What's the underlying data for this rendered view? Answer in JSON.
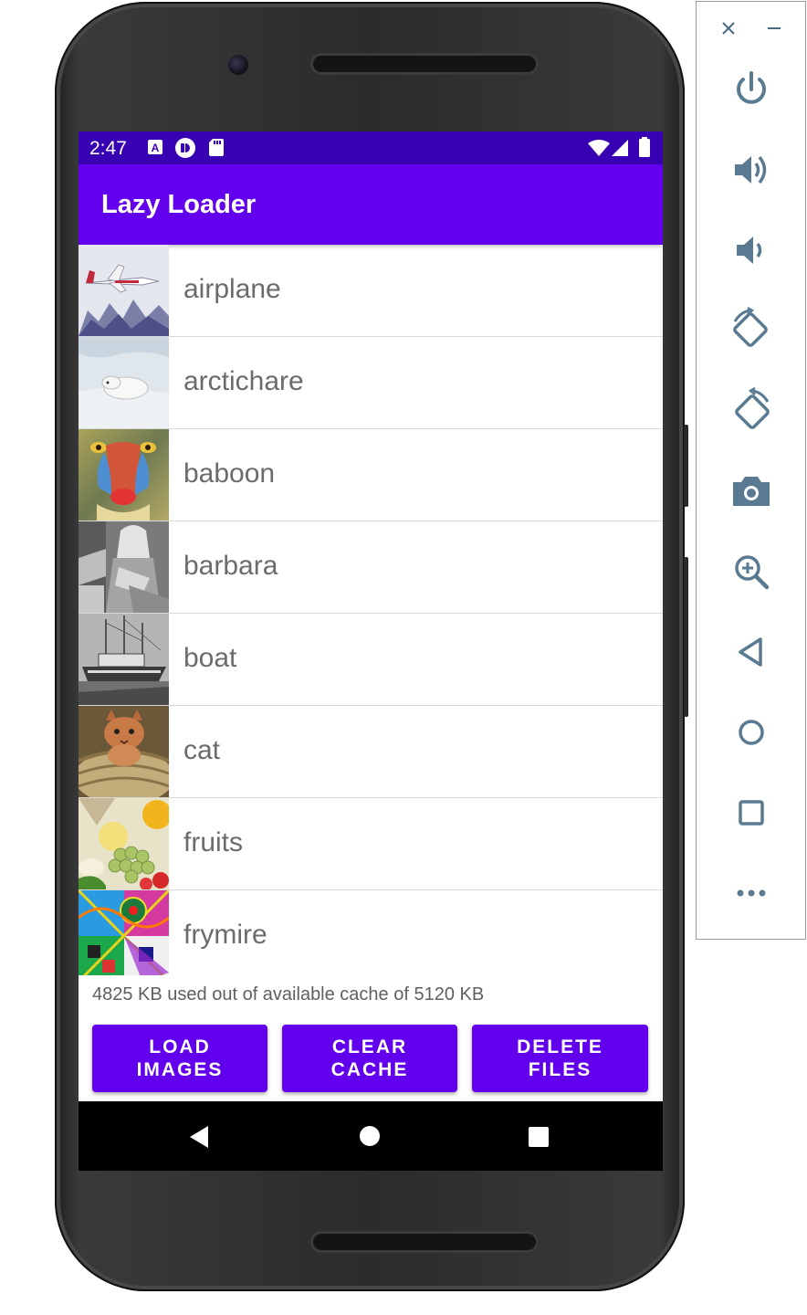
{
  "status_bar": {
    "time": "2:47",
    "left_icons": [
      "a-notification-icon",
      "headset-notification-icon",
      "sd-card-icon"
    ],
    "right_icons": [
      "wifi-icon",
      "signal-icon",
      "battery-icon"
    ]
  },
  "app_bar": {
    "title": "Lazy Loader"
  },
  "images": [
    {
      "label": "airplane"
    },
    {
      "label": "arctichare"
    },
    {
      "label": "baboon"
    },
    {
      "label": "barbara"
    },
    {
      "label": "boat"
    },
    {
      "label": "cat"
    },
    {
      "label": "fruits"
    },
    {
      "label": "frymire"
    }
  ],
  "cache_status": "4825 KB used out of available cache of 5120 KB",
  "buttons": {
    "load": "LOAD\nIMAGES",
    "clear": "CLEAR\nCACHE",
    "delete": "DELETE\nFILES"
  },
  "nav_bar": [
    "back-icon",
    "home-icon",
    "recents-icon"
  ],
  "emulator_toolbar": [
    "close-icon",
    "minimize-icon",
    "power-icon",
    "volume-up-icon",
    "volume-down-icon",
    "rotate-left-icon",
    "rotate-right-icon",
    "camera-icon",
    "zoom-icon",
    "back-icon",
    "home-icon",
    "overview-icon",
    "more-icon"
  ],
  "colors": {
    "status_bar": "#3700b3",
    "primary": "#6200ee",
    "nav_bar": "#000000"
  }
}
